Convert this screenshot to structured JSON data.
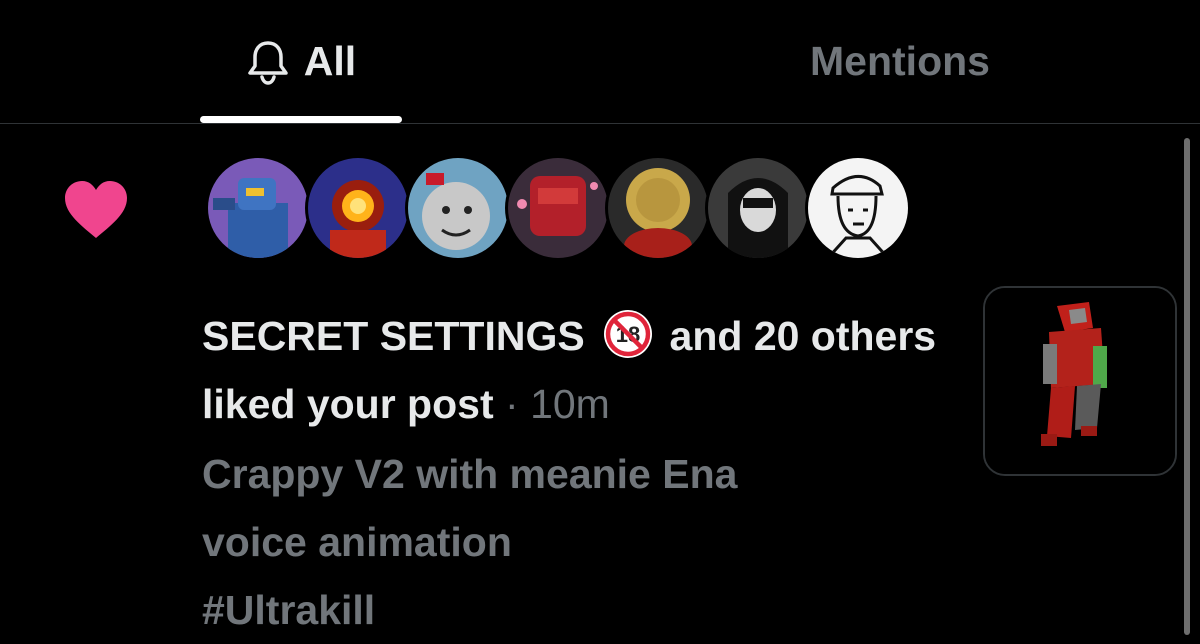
{
  "tabs": {
    "all_label": "All",
    "all_icon": "bell-icon",
    "mentions_label": "Mentions",
    "active": "All"
  },
  "notification": {
    "icon": "heart-icon",
    "icon_color": "#f0458e",
    "actor_name": "SECRET SETTINGS",
    "badge_text": "18",
    "rest_line": "and 20 others liked your post",
    "separator": "·",
    "time": "10m",
    "post_title_line1": "Crappy V2 with meanie Ena",
    "post_title_line2": "voice animation",
    "post_hashtag": "#Ultrakill",
    "avatars": [
      {
        "name": "avatar-blue-robot"
      },
      {
        "name": "avatar-red-eye-robot"
      },
      {
        "name": "avatar-gray-cartoon"
      },
      {
        "name": "avatar-red-robot"
      },
      {
        "name": "avatar-gold-coin"
      },
      {
        "name": "avatar-anime-girl"
      },
      {
        "name": "avatar-sketch-person"
      }
    ]
  },
  "colors": {
    "background": "#000000",
    "primary_text": "#e7e9ea",
    "secondary_text": "#71767b",
    "like_pink": "#f0458e"
  }
}
